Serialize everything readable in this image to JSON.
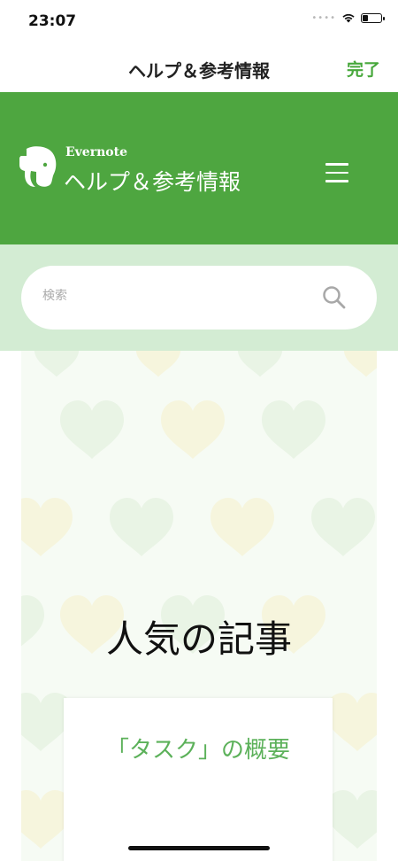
{
  "status_bar": {
    "time": "23:07"
  },
  "nav": {
    "title": "ヘルプ＆参考情報",
    "done_label": "完了"
  },
  "header": {
    "brand": "Evernote",
    "title": "ヘルプ＆参考情報"
  },
  "search": {
    "placeholder": "検索",
    "value": ""
  },
  "hero": {
    "title": "人気の記事"
  },
  "articles": [
    {
      "title": "「タスク」の概要"
    }
  ],
  "colors": {
    "brand_green": "#4ea640",
    "accent_green": "#48a83c",
    "search_band": "#d3ecd3",
    "link_green": "#5cb15a"
  },
  "icons": [
    "wifi-icon",
    "battery-icon",
    "elephant-logo-icon",
    "hamburger-menu-icon",
    "search-icon",
    "heart-pattern"
  ]
}
